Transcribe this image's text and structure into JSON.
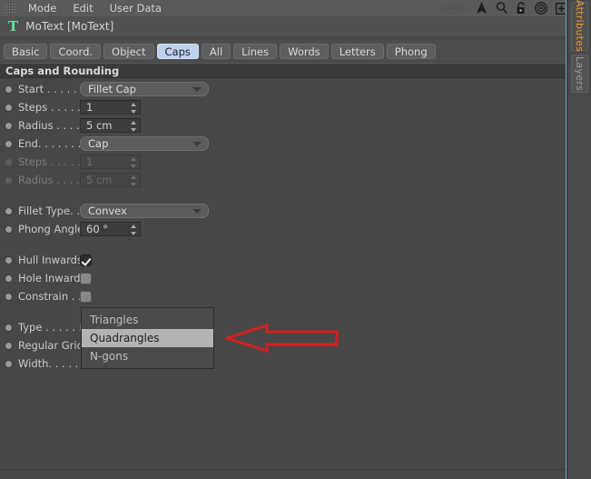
{
  "window": {
    "menubar": {
      "grip_icon": "drag-grip-icon",
      "items": [
        "Mode",
        "Edit",
        "User Data"
      ],
      "right_icons": [
        {
          "name": "wireframe-icon",
          "glyph": "wireframe"
        },
        {
          "name": "cursor-arrow-icon",
          "glyph": "cursor"
        },
        {
          "name": "search-icon",
          "glyph": "magnifier"
        },
        {
          "name": "unlock-icon",
          "glyph": "padlock-open"
        },
        {
          "name": "target-icon",
          "glyph": "concentric-circles"
        },
        {
          "name": "add-box-icon",
          "glyph": "plus-in-square"
        }
      ]
    },
    "object": {
      "icon": "motext-t-icon",
      "icon_letter": "T",
      "icon_color": "#5fe39a",
      "title": "MoText [MoText]"
    },
    "tabs": [
      {
        "label": "Basic",
        "active": false
      },
      {
        "label": "Coord.",
        "active": false
      },
      {
        "label": "Object",
        "active": false
      },
      {
        "label": "Caps",
        "active": true
      },
      {
        "label": "All",
        "active": false
      },
      {
        "label": "Lines",
        "active": false
      },
      {
        "label": "Words",
        "active": false
      },
      {
        "label": "Letters",
        "active": false
      },
      {
        "label": "Phong",
        "active": false
      }
    ],
    "active_tab_color": "#bed2ef"
  },
  "group": {
    "header": "Caps and Rounding"
  },
  "properties": [
    {
      "label": "Start . . . . . . .",
      "type": "combo",
      "value": "Fillet Cap",
      "disabled": false,
      "name": "start"
    },
    {
      "label": "Steps . . . . . . ",
      "type": "number",
      "value": "1",
      "disabled": false,
      "name": "steps-1"
    },
    {
      "label": "Radius . . . . . ",
      "type": "number",
      "value": "5 cm",
      "disabled": false,
      "name": "radius-1"
    },
    {
      "label": "End. . . . . . . . ",
      "type": "combo",
      "value": "Cap",
      "disabled": false,
      "name": "end"
    },
    {
      "label": "Steps . . . . . . ",
      "type": "number",
      "value": "1",
      "disabled": true,
      "name": "steps-2"
    },
    {
      "label": "Radius . . . . . ",
      "type": "number",
      "value": "5 cm",
      "disabled": true,
      "name": "radius-2"
    },
    {
      "label": "Fillet Type. . . ",
      "type": "combo",
      "value": "Convex",
      "disabled": false,
      "name": "fillet-type"
    },
    {
      "label": "Phong Angle",
      "type": "number",
      "value": "60 °",
      "disabled": false,
      "name": "phong-angle"
    },
    {
      "label": "Hull Inwards",
      "type": "checkbox",
      "checked": true,
      "disabled": false,
      "name": "hull-inwards"
    },
    {
      "label": "Hole Inwards",
      "type": "checkbox",
      "checked": false,
      "disabled": false,
      "name": "hole-inwards"
    },
    {
      "label": "Constrain . . . ",
      "type": "checkbox",
      "checked": false,
      "disabled": false,
      "name": "constrain"
    },
    {
      "label": "Type . . . . . . . ",
      "type": "combo",
      "value": "Quadrangles",
      "disabled": false,
      "name": "type"
    },
    {
      "label": "Regular Grid",
      "type": "hidden",
      "value": "",
      "disabled": false,
      "name": "regular-grid"
    },
    {
      "label": "Width. . . . . . ",
      "type": "hidden",
      "value": "",
      "disabled": false,
      "name": "width"
    }
  ],
  "dropdown": {
    "open": true,
    "options": [
      {
        "label": "Triangles",
        "selected": false
      },
      {
        "label": "Quadrangles",
        "selected": true
      },
      {
        "label": "N-gons",
        "selected": false
      }
    ],
    "highlight_color": "#b3b3b3"
  },
  "annotation": {
    "type": "arrow",
    "direction": "left",
    "color": "#cc2222",
    "name": "red-pointer-arrow"
  },
  "side_rail": {
    "tabs": [
      {
        "label": "Attributes",
        "active": true,
        "color": "#e49a3c"
      },
      {
        "label": "Layers",
        "active": false,
        "color": "#9a9a9a"
      }
    ]
  },
  "theme": {
    "background": "#474747",
    "menubar_bg": "#5a5a5a",
    "group_header_bg": "#3a3a3a",
    "accent": "#bed2ef"
  }
}
